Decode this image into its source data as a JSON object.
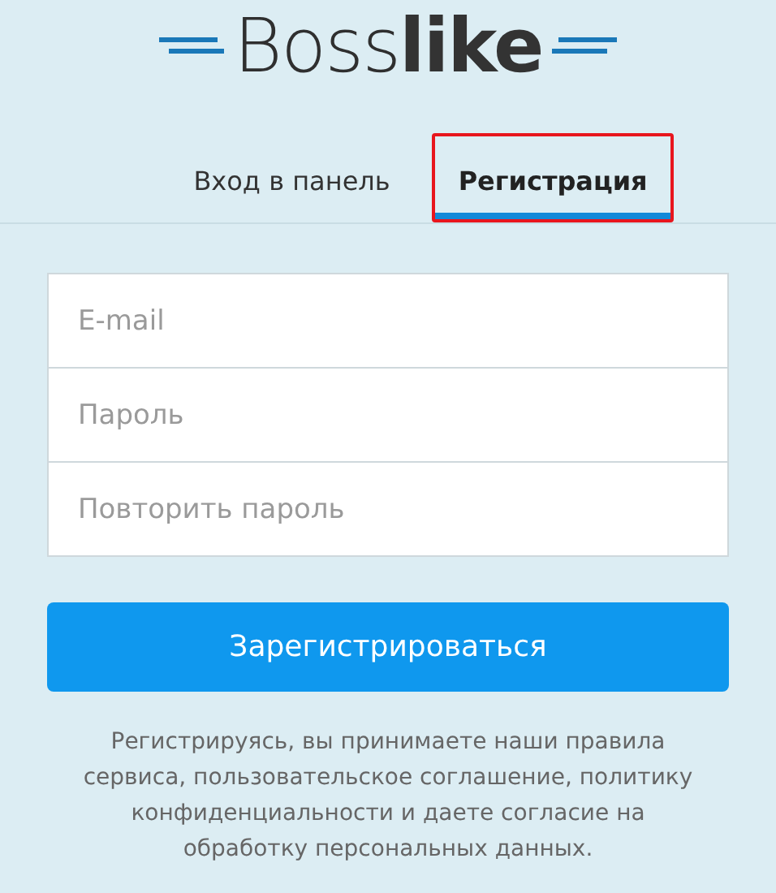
{
  "logo": {
    "text": "Boss**like**"
  },
  "tabs": [
    {
      "label": "Вход в панель",
      "selected": false,
      "highlighted": false
    },
    {
      "label": "Регистрация",
      "selected": true,
      "highlighted": true
    }
  ],
  "fields": [
    {
      "placeholder": "E-mail"
    },
    {
      "placeholder": "Пароль"
    },
    {
      "placeholder": "Повторить пароль"
    }
  ],
  "submit_button": "Зарегистрироваться",
  "terms": "Регистрируясь, вы принимаете наши правила сервиса, пользовательское соглашение, политику конфиденциальности и даете согласие на обработку персональных данных."
}
